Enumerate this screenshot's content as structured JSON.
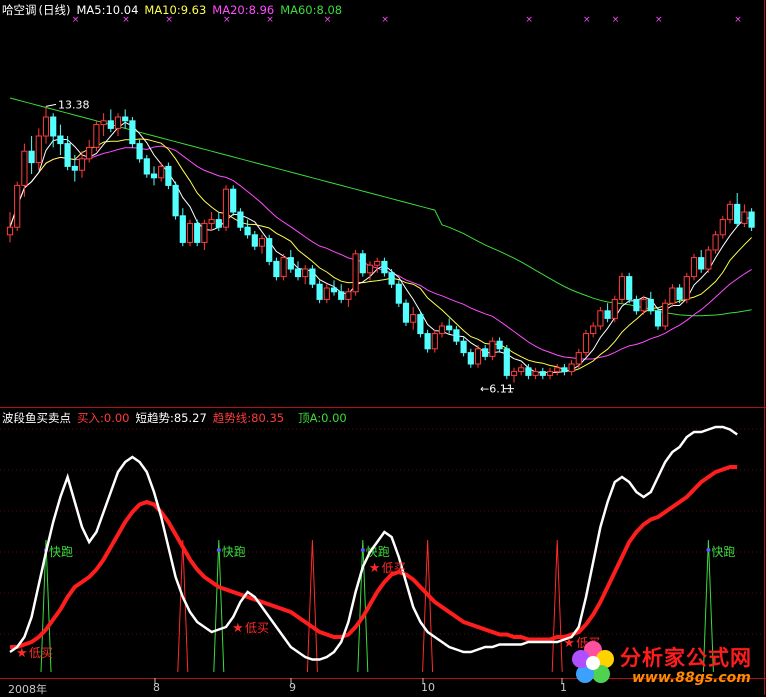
{
  "header": {
    "title": "哈空调",
    "period": "(日线)",
    "ma5": "MA5:10.04",
    "ma10": "MA10:9.63",
    "ma20": "MA20:8.96",
    "ma60": "MA60:8.08"
  },
  "indicator": {
    "name": "波段鱼买卖点",
    "buy": "买入:0.00",
    "short_trend": "短趋势:85.27",
    "trend_line": "趋势线:80.35",
    "top": "顶A:0.00"
  },
  "annotations": {
    "high": "13.38",
    "low": "6.11",
    "quick_run": "快跑",
    "low_buy": "低买"
  },
  "x_axis": [
    "2008年",
    "8",
    "9",
    "10",
    "1"
  ],
  "watermark": {
    "text": "分析家公式网",
    "url": "www.88gs.com"
  },
  "colors": {
    "up": "#ff3c3c",
    "down": "#54ffff",
    "ma5": "#ffffff",
    "ma10": "#ffff4c",
    "ma20": "#ff4cff",
    "ma60": "#3cdc3c",
    "short_trend": "#ffffff",
    "trend_line": "#ff1e1e",
    "frame": "#b01010"
  },
  "chart_data": [
    {
      "type": "candlestick",
      "title": "哈空调 (日线)",
      "ylim": [
        5.6,
        15.6
      ],
      "high_mark": 13.38,
      "low_mark": 6.11,
      "candles": [
        [
          10.0,
          10.6,
          9.8,
          10.2
        ],
        [
          10.2,
          11.4,
          10.1,
          11.3
        ],
        [
          11.3,
          12.4,
          11.0,
          12.2
        ],
        [
          12.2,
          12.6,
          11.6,
          11.9
        ],
        [
          11.9,
          12.8,
          11.7,
          12.6
        ],
        [
          12.6,
          13.38,
          12.4,
          13.1
        ],
        [
          13.1,
          13.2,
          12.3,
          12.6
        ],
        [
          12.6,
          12.9,
          12.1,
          12.4
        ],
        [
          12.4,
          12.6,
          11.7,
          11.8
        ],
        [
          11.8,
          12.1,
          11.4,
          11.7
        ],
        [
          11.7,
          12.2,
          11.5,
          12.0
        ],
        [
          12.0,
          12.5,
          11.9,
          12.3
        ],
        [
          12.3,
          13.0,
          12.2,
          12.9
        ],
        [
          12.9,
          13.2,
          12.6,
          13.0
        ],
        [
          13.0,
          13.3,
          12.7,
          12.8
        ],
        [
          12.8,
          13.2,
          12.6,
          13.1
        ],
        [
          13.1,
          13.3,
          12.8,
          13.0
        ],
        [
          13.0,
          13.1,
          12.3,
          12.4
        ],
        [
          12.4,
          12.5,
          11.9,
          12.0
        ],
        [
          12.0,
          12.1,
          11.5,
          11.6
        ],
        [
          11.6,
          11.8,
          11.3,
          11.5
        ],
        [
          11.5,
          11.9,
          11.4,
          11.8
        ],
        [
          11.8,
          11.9,
          11.2,
          11.3
        ],
        [
          11.3,
          11.4,
          10.4,
          10.5
        ],
        [
          10.5,
          10.7,
          9.7,
          9.8
        ],
        [
          9.8,
          10.4,
          9.7,
          10.3
        ],
        [
          10.3,
          10.4,
          9.7,
          9.8
        ],
        [
          9.8,
          10.4,
          9.6,
          10.3
        ],
        [
          10.3,
          10.6,
          10.1,
          10.4
        ],
        [
          10.4,
          10.6,
          10.1,
          10.2
        ],
        [
          10.2,
          11.3,
          10.1,
          11.2
        ],
        [
          11.2,
          11.3,
          10.5,
          10.6
        ],
        [
          10.6,
          10.7,
          10.1,
          10.2
        ],
        [
          10.2,
          10.4,
          9.9,
          10.0
        ],
        [
          10.0,
          10.1,
          9.6,
          9.7
        ],
        [
          9.7,
          10.0,
          9.5,
          9.9
        ],
        [
          9.9,
          10.0,
          9.2,
          9.3
        ],
        [
          9.3,
          9.4,
          8.8,
          8.9
        ],
        [
          8.9,
          9.5,
          8.8,
          9.4
        ],
        [
          9.4,
          9.6,
          9.0,
          9.1
        ],
        [
          9.1,
          9.3,
          8.8,
          8.9
        ],
        [
          8.9,
          9.2,
          8.7,
          9.1
        ],
        [
          9.1,
          9.2,
          8.6,
          8.7
        ],
        [
          8.7,
          8.8,
          8.2,
          8.3
        ],
        [
          8.3,
          8.7,
          8.2,
          8.6
        ],
        [
          8.6,
          8.8,
          8.4,
          8.5
        ],
        [
          8.5,
          8.7,
          8.2,
          8.3
        ],
        [
          8.3,
          8.6,
          8.1,
          8.5
        ],
        [
          8.5,
          9.6,
          8.4,
          9.5
        ],
        [
          9.5,
          9.6,
          8.9,
          9.0
        ],
        [
          9.0,
          9.3,
          8.8,
          9.2
        ],
        [
          9.2,
          9.4,
          9.0,
          9.3
        ],
        [
          9.3,
          9.4,
          8.9,
          9.0
        ],
        [
          9.0,
          9.1,
          8.6,
          8.7
        ],
        [
          8.7,
          8.8,
          8.1,
          8.2
        ],
        [
          8.2,
          8.3,
          7.6,
          7.7
        ],
        [
          7.7,
          8.1,
          7.5,
          7.9
        ],
        [
          7.9,
          8.0,
          7.3,
          7.4
        ],
        [
          7.4,
          7.5,
          6.9,
          7.0
        ],
        [
          7.0,
          7.5,
          6.9,
          7.4
        ],
        [
          7.4,
          7.7,
          7.3,
          7.6
        ],
        [
          7.6,
          7.8,
          7.4,
          7.5
        ],
        [
          7.5,
          7.6,
          7.1,
          7.2
        ],
        [
          7.2,
          7.3,
          6.8,
          6.9
        ],
        [
          6.9,
          7.0,
          6.5,
          6.6
        ],
        [
          6.6,
          7.1,
          6.5,
          7.0
        ],
        [
          7.0,
          7.1,
          6.7,
          6.8
        ],
        [
          6.8,
          7.3,
          6.7,
          7.2
        ],
        [
          7.2,
          7.3,
          6.9,
          7.0
        ],
        [
          7.0,
          7.1,
          6.2,
          6.3
        ],
        [
          6.3,
          6.5,
          6.11,
          6.4
        ],
        [
          6.4,
          6.6,
          6.3,
          6.5
        ],
        [
          6.5,
          6.6,
          6.2,
          6.3
        ],
        [
          6.3,
          6.5,
          6.2,
          6.4
        ],
        [
          6.4,
          6.5,
          6.2,
          6.3
        ],
        [
          6.3,
          6.5,
          6.2,
          6.4
        ],
        [
          6.4,
          6.6,
          6.3,
          6.5
        ],
        [
          6.5,
          6.6,
          6.3,
          6.4
        ],
        [
          6.4,
          6.7,
          6.3,
          6.6
        ],
        [
          6.6,
          7.0,
          6.5,
          6.9
        ],
        [
          6.9,
          7.5,
          6.8,
          7.4
        ],
        [
          7.4,
          7.7,
          7.3,
          7.6
        ],
        [
          7.6,
          8.1,
          7.5,
          8.0
        ],
        [
          8.0,
          8.2,
          7.7,
          7.8
        ],
        [
          7.8,
          8.4,
          7.7,
          8.3
        ],
        [
          8.3,
          9.0,
          8.2,
          8.9
        ],
        [
          8.9,
          9.0,
          8.2,
          8.3
        ],
        [
          8.3,
          8.4,
          7.9,
          8.0
        ],
        [
          8.0,
          8.4,
          7.9,
          8.3
        ],
        [
          8.3,
          8.5,
          7.9,
          8.0
        ],
        [
          8.0,
          8.1,
          7.5,
          7.6
        ],
        [
          7.6,
          8.3,
          7.5,
          8.2
        ],
        [
          8.2,
          8.7,
          8.1,
          8.6
        ],
        [
          8.6,
          8.7,
          8.2,
          8.3
        ],
        [
          8.3,
          9.0,
          8.2,
          8.9
        ],
        [
          8.9,
          9.5,
          8.8,
          9.4
        ],
        [
          9.4,
          9.6,
          9.0,
          9.1
        ],
        [
          9.1,
          9.7,
          9.0,
          9.6
        ],
        [
          9.6,
          10.1,
          9.5,
          10.0
        ],
        [
          10.0,
          10.5,
          9.9,
          10.4
        ],
        [
          10.4,
          10.9,
          10.3,
          10.8
        ],
        [
          10.8,
          11.1,
          10.2,
          10.3
        ],
        [
          10.3,
          10.8,
          10.2,
          10.6
        ],
        [
          10.6,
          10.7,
          10.1,
          10.2
        ]
      ]
    },
    {
      "type": "line",
      "title": "波段鱼买卖点",
      "ylim": [
        0,
        100
      ],
      "series": [
        {
          "name": "短趋势",
          "values": [
            8,
            10,
            14,
            22,
            35,
            48,
            60,
            70,
            78,
            68,
            58,
            52,
            56,
            64,
            72,
            80,
            84,
            86,
            84,
            80,
            72,
            62,
            50,
            38,
            30,
            24,
            20,
            18,
            16,
            17,
            18,
            22,
            28,
            32,
            30,
            26,
            22,
            18,
            14,
            10,
            8,
            6,
            5,
            5,
            6,
            8,
            12,
            20,
            32,
            42,
            48,
            52,
            56,
            54,
            46,
            36,
            26,
            20,
            16,
            14,
            12,
            10,
            9,
            8,
            8,
            9,
            10,
            10,
            11,
            11,
            11,
            11,
            12,
            12,
            12,
            12,
            12,
            13,
            14,
            18,
            30,
            44,
            58,
            68,
            76,
            78,
            76,
            72,
            70,
            72,
            78,
            84,
            88,
            90,
            94,
            96,
            96,
            97,
            98,
            98,
            97,
            95
          ]
        },
        {
          "name": "趋势线",
          "values": [
            10,
            10,
            11,
            12,
            14,
            17,
            21,
            25,
            30,
            34,
            36,
            38,
            41,
            45,
            50,
            55,
            60,
            64,
            67,
            68,
            67,
            64,
            60,
            55,
            50,
            45,
            41,
            38,
            36,
            34,
            33,
            32,
            31,
            30,
            29,
            28,
            27,
            26,
            25,
            24,
            22,
            20,
            18,
            16,
            15,
            14,
            14,
            15,
            18,
            22,
            27,
            32,
            36,
            39,
            40,
            39,
            37,
            34,
            31,
            28,
            26,
            24,
            22,
            20,
            19,
            18,
            17,
            16,
            15,
            15,
            14,
            14,
            13,
            13,
            13,
            13,
            14,
            14,
            15,
            16,
            19,
            23,
            28,
            34,
            40,
            46,
            52,
            56,
            59,
            61,
            62,
            64,
            66,
            68,
            70,
            73,
            76,
            78,
            80,
            81,
            82,
            82
          ]
        }
      ],
      "signals": [
        {
          "index": 0,
          "label": "低买"
        },
        {
          "index": 5,
          "label": "快跑"
        },
        {
          "index": 29,
          "label": "快跑"
        },
        {
          "index": 30,
          "label": "低买"
        },
        {
          "index": 49,
          "label": "快跑"
        },
        {
          "index": 49,
          "label": "低买"
        },
        {
          "index": 76,
          "label": "低买"
        },
        {
          "index": 97,
          "label": "快跑"
        }
      ],
      "red_spikes": [
        24,
        42,
        58,
        76
      ]
    }
  ]
}
